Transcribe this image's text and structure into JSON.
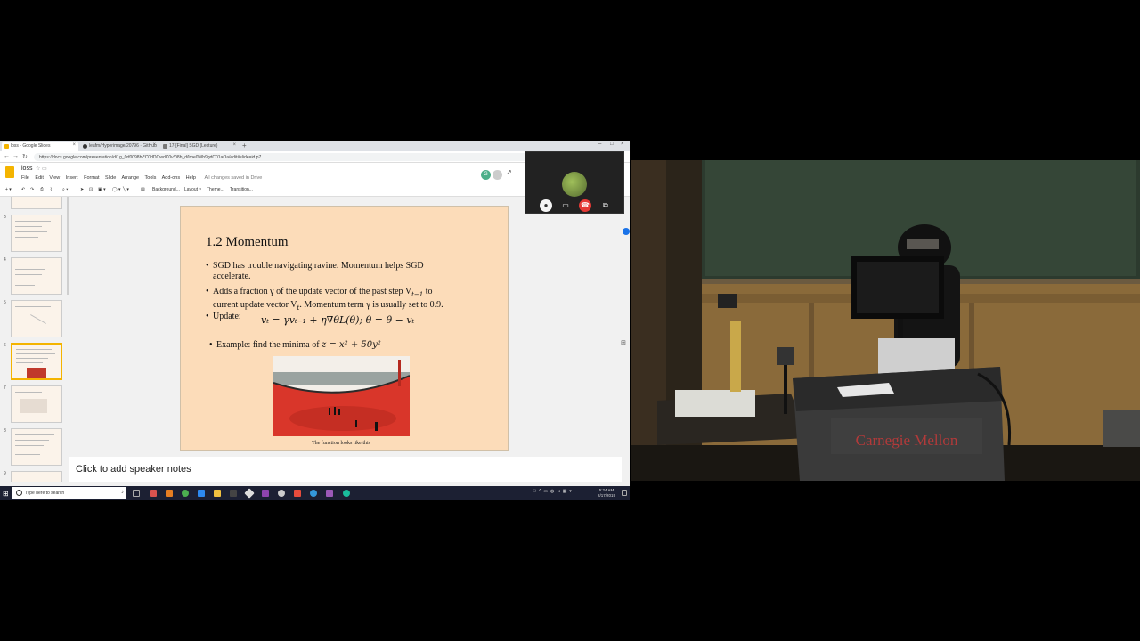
{
  "browser": {
    "tabs": [
      {
        "label": "loss - Google Slides",
        "color": "#f4b400"
      },
      {
        "label": "leafm/Hyperimage/20796 · GitHub",
        "color": "#333333"
      },
      {
        "label": "17-[Final] SGD (Lecture)",
        "color": "#777777"
      }
    ],
    "url": "https://docs.google.com/presentation/d/1g_0rf0098b/*C0dDOwdC0vYi8h_d/lrbe0Wb9gdC01aOa/edit#slide=id.p7"
  },
  "app": {
    "doc_title": "loss",
    "menus": [
      "File",
      "Edit",
      "View",
      "Insert",
      "Format",
      "Slide",
      "Arrange",
      "Tools",
      "Add-ons",
      "Help"
    ],
    "saved_status": "All changes saved in Drive",
    "toolbar": {
      "background": "Background...",
      "layout": "Layout ▾",
      "theme": "Theme...",
      "transition": "Transition..."
    }
  },
  "filmstrip": {
    "numbers": [
      "3",
      "4",
      "5",
      "6",
      "7",
      "8",
      "9",
      "10"
    ],
    "selected_index": 3
  },
  "slide": {
    "title": "1.2 Momentum",
    "bullet1": "SGD has trouble navigating ravine. Momentum helps SGD",
    "bullet1b": "accelerate.",
    "bullet2": "Adds a fraction γ of the update vector of the past step  V",
    "bullet2_sub": "t−1",
    "bullet2_end": " to",
    "bullet2b": "current update vector V",
    "bullet2b_sub": "t",
    "bullet2b_end": ". Momentum term γ is usually set to 0.9.",
    "bullet3": "Update:",
    "equation": "vₜ = γvₜ₋₁ + η∇θL(θ);     θ = θ − vₜ",
    "bullet4": "Example: find the minima of ",
    "bullet4_math": "z = x² + 50y²",
    "caption": "The function looks like this"
  },
  "notes": {
    "placeholder": "Click to add speaker notes"
  },
  "taskbar": {
    "search_placeholder": "Type here to search",
    "clock_time": "5:24 AM",
    "clock_date": "2/17/2019"
  },
  "video": {
    "podium_text": "Carnegie Mellon"
  },
  "colors": {
    "slide_bg": "#fcdcb9",
    "accent_yellow": "#f4b400",
    "end_call_red": "#e53935"
  }
}
